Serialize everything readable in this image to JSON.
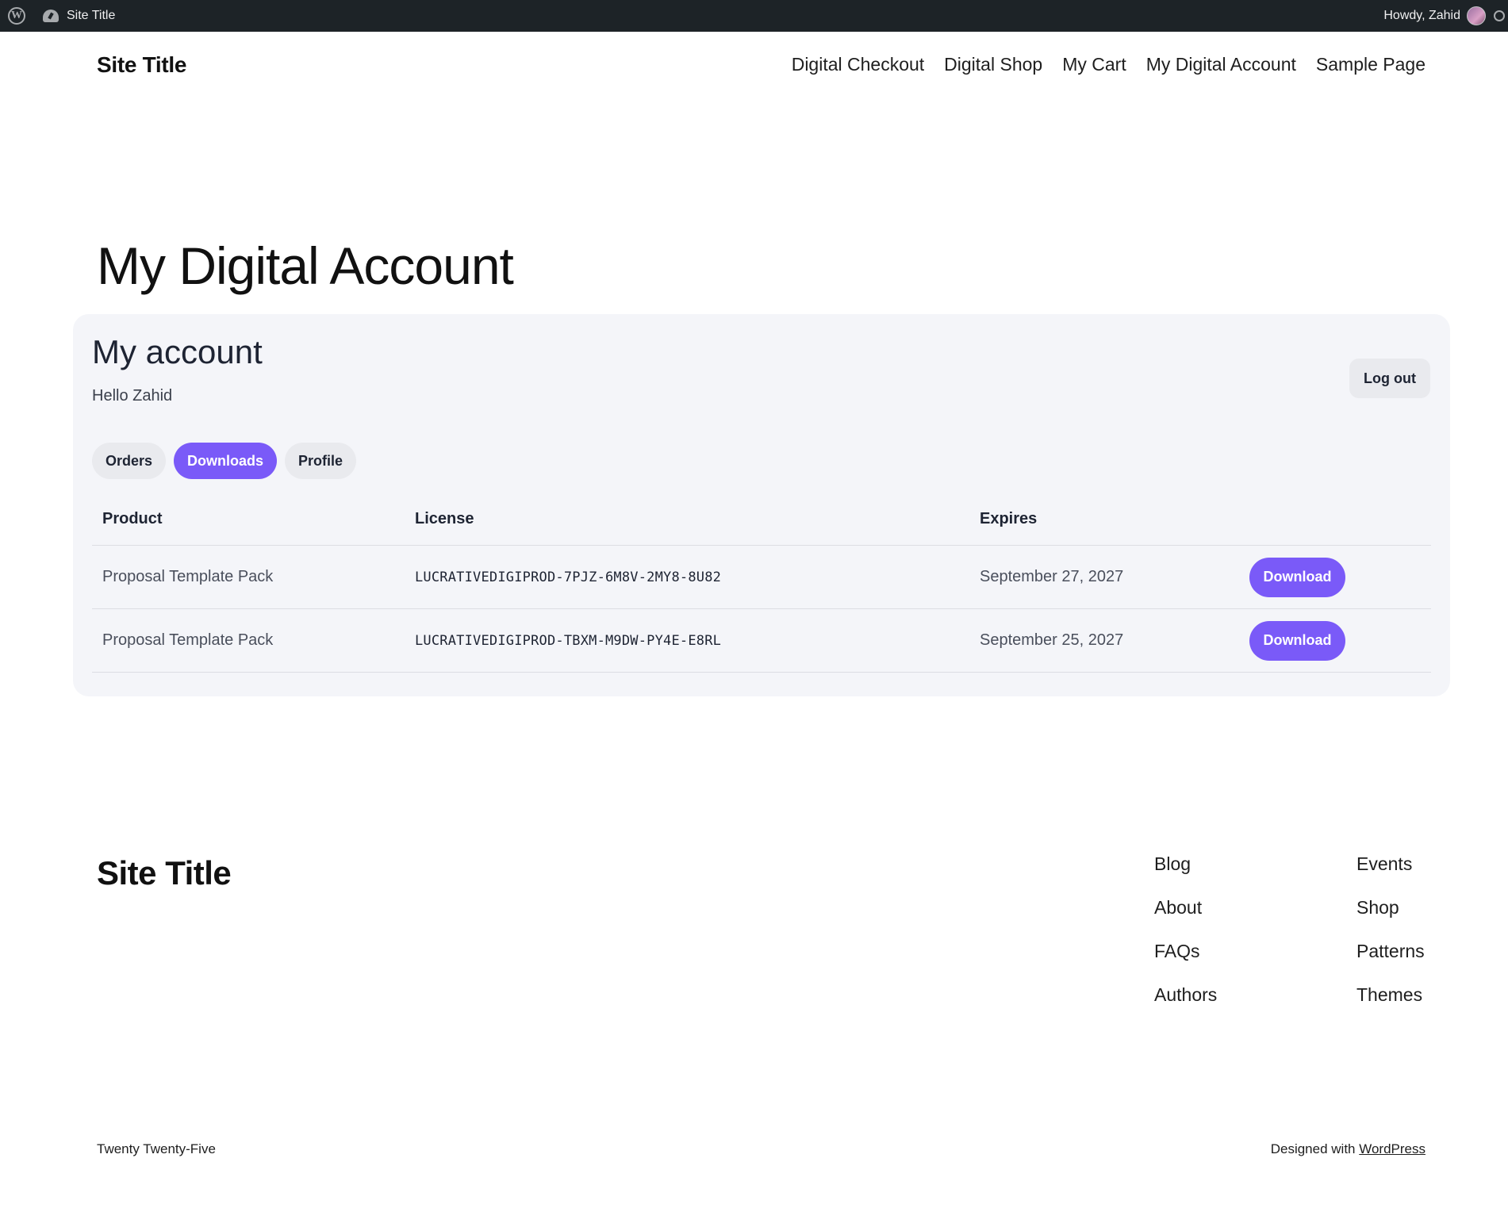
{
  "admin_bar": {
    "site_name": "Site Title",
    "howdy": "Howdy, Zahid"
  },
  "header": {
    "site_title": "Site Title",
    "nav": [
      "Digital Checkout",
      "Digital Shop",
      "My Cart",
      "My Digital Account",
      "Sample Page"
    ]
  },
  "page": {
    "title": "My Digital Account"
  },
  "account": {
    "heading": "My account",
    "greeting": "Hello Zahid",
    "logout_label": "Log out",
    "tabs": [
      {
        "label": "Orders",
        "active": false
      },
      {
        "label": "Downloads",
        "active": true
      },
      {
        "label": "Profile",
        "active": false
      }
    ],
    "table": {
      "headers": [
        "Product",
        "License",
        "Expires",
        ""
      ],
      "rows": [
        {
          "product": "Proposal Template Pack",
          "license": "LUCRATIVEDIGIPROD-7PJZ-6M8V-2MY8-8U82",
          "expires": "September 27, 2027",
          "action": "Download"
        },
        {
          "product": "Proposal Template Pack",
          "license": "LUCRATIVEDIGIPROD-TBXM-M9DW-PY4E-E8RL",
          "expires": "September 25, 2027",
          "action": "Download"
        }
      ]
    }
  },
  "footer": {
    "site_title": "Site Title",
    "col1": [
      "Blog",
      "About",
      "FAQs",
      "Authors"
    ],
    "col2": [
      "Events",
      "Shop",
      "Patterns",
      "Themes"
    ],
    "theme_credit": "Twenty Twenty-Five",
    "designed_prefix": "Designed with ",
    "designed_link": "WordPress"
  },
  "colors": {
    "accent": "#7a5af8",
    "panel_bg": "#f4f5f9",
    "admin_bar_bg": "#1d2327"
  }
}
